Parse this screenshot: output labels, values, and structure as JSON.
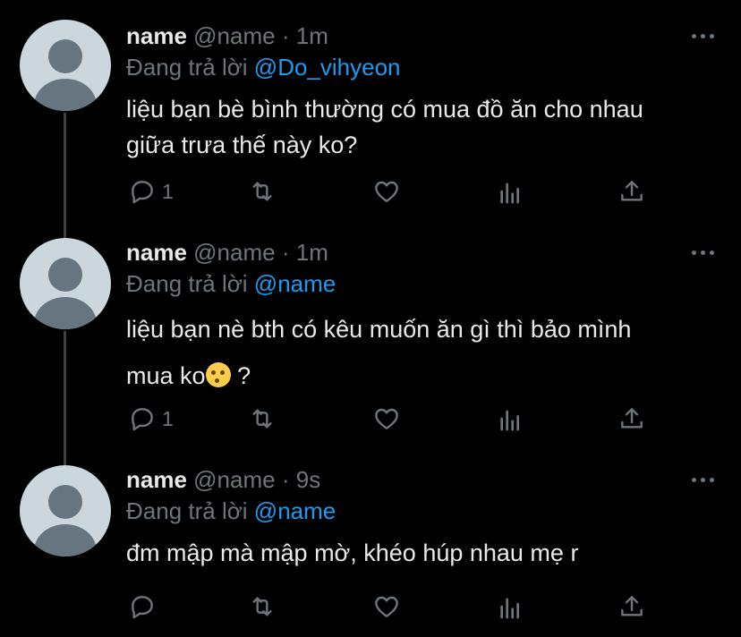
{
  "tweets": [
    {
      "name": "name",
      "handle": "@name",
      "separator": "·",
      "time": "1m",
      "reply_label": "Đang trả lời",
      "reply_to": "@Do_vihyeon",
      "text_line1": "liệu bạn bè bình thường có mua đồ ăn cho nhau",
      "text_line2": "giữa trưa thế này ko?",
      "reply_count": "1"
    },
    {
      "name": "name",
      "handle": "@name",
      "separator": "·",
      "time": "1m",
      "reply_label": "Đang trả lời",
      "reply_to": "@name",
      "text_line1": "liệu bạn nè bth có kêu muốn ăn gì thì bảo mình",
      "text_line2": "mua ko",
      "text_line2_tail": "?",
      "reply_count": "1"
    },
    {
      "name": "name",
      "handle": "@name",
      "separator": "·",
      "time": "9s",
      "reply_label": "Đang trả lời",
      "reply_to": "@name",
      "text_line1": "đm mập mà mập mờ, khéo húp nhau mẹ r",
      "reply_count": ""
    }
  ],
  "icons": {
    "reply": "reply-icon",
    "retweet": "retweet-icon",
    "like": "heart-icon",
    "analytics": "analytics-icon",
    "share": "share-icon",
    "more": "more-dots-icon",
    "emoji": "raised-eyebrow-emoji"
  },
  "colors": {
    "background": "#000000",
    "text": "#e7e9ea",
    "secondary": "#6e767d",
    "mention": "#1d9bf0",
    "thread_line": "#3e4144"
  }
}
